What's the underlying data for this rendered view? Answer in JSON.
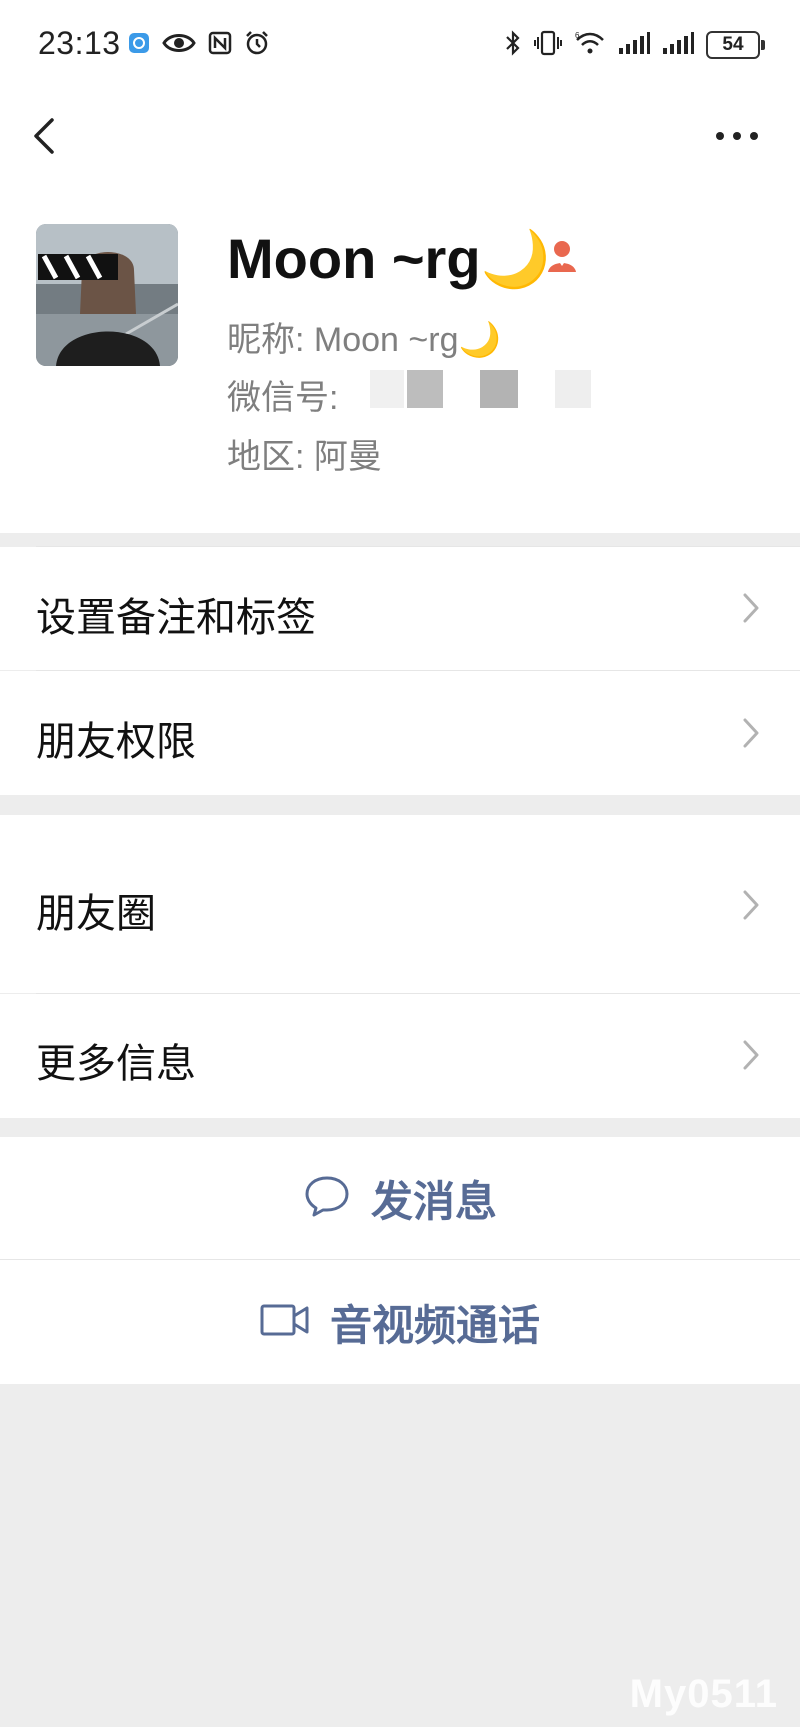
{
  "status_bar": {
    "time": "23:13",
    "battery": "54",
    "left_icons": [
      "app-notification-icon",
      "eye-icon",
      "nfc-icon",
      "alarm-icon"
    ],
    "right_icons": [
      "bluetooth-icon",
      "vibrate-icon",
      "wifi-icon",
      "signal-icon",
      "signal-icon"
    ]
  },
  "profile": {
    "display_name": "Moon ~rg",
    "moon_emoji": "🌙",
    "nickname_label": "昵称:",
    "nickname_value": "Moon ~rg🌙",
    "wechat_id_label": "微信号:",
    "region_label": "地区:",
    "region_value": "阿曼"
  },
  "menu": {
    "items": [
      {
        "label": "设置备注和标签"
      },
      {
        "label": "朋友权限"
      },
      {
        "label": "朋友圈"
      },
      {
        "label": "更多信息"
      }
    ]
  },
  "actions": {
    "send_message": "发消息",
    "av_call": "音视频通话"
  },
  "colors": {
    "link_blue": "#576b95",
    "background_gray": "#ededed",
    "female_icon": "#e9684f"
  },
  "watermark": "My0511"
}
